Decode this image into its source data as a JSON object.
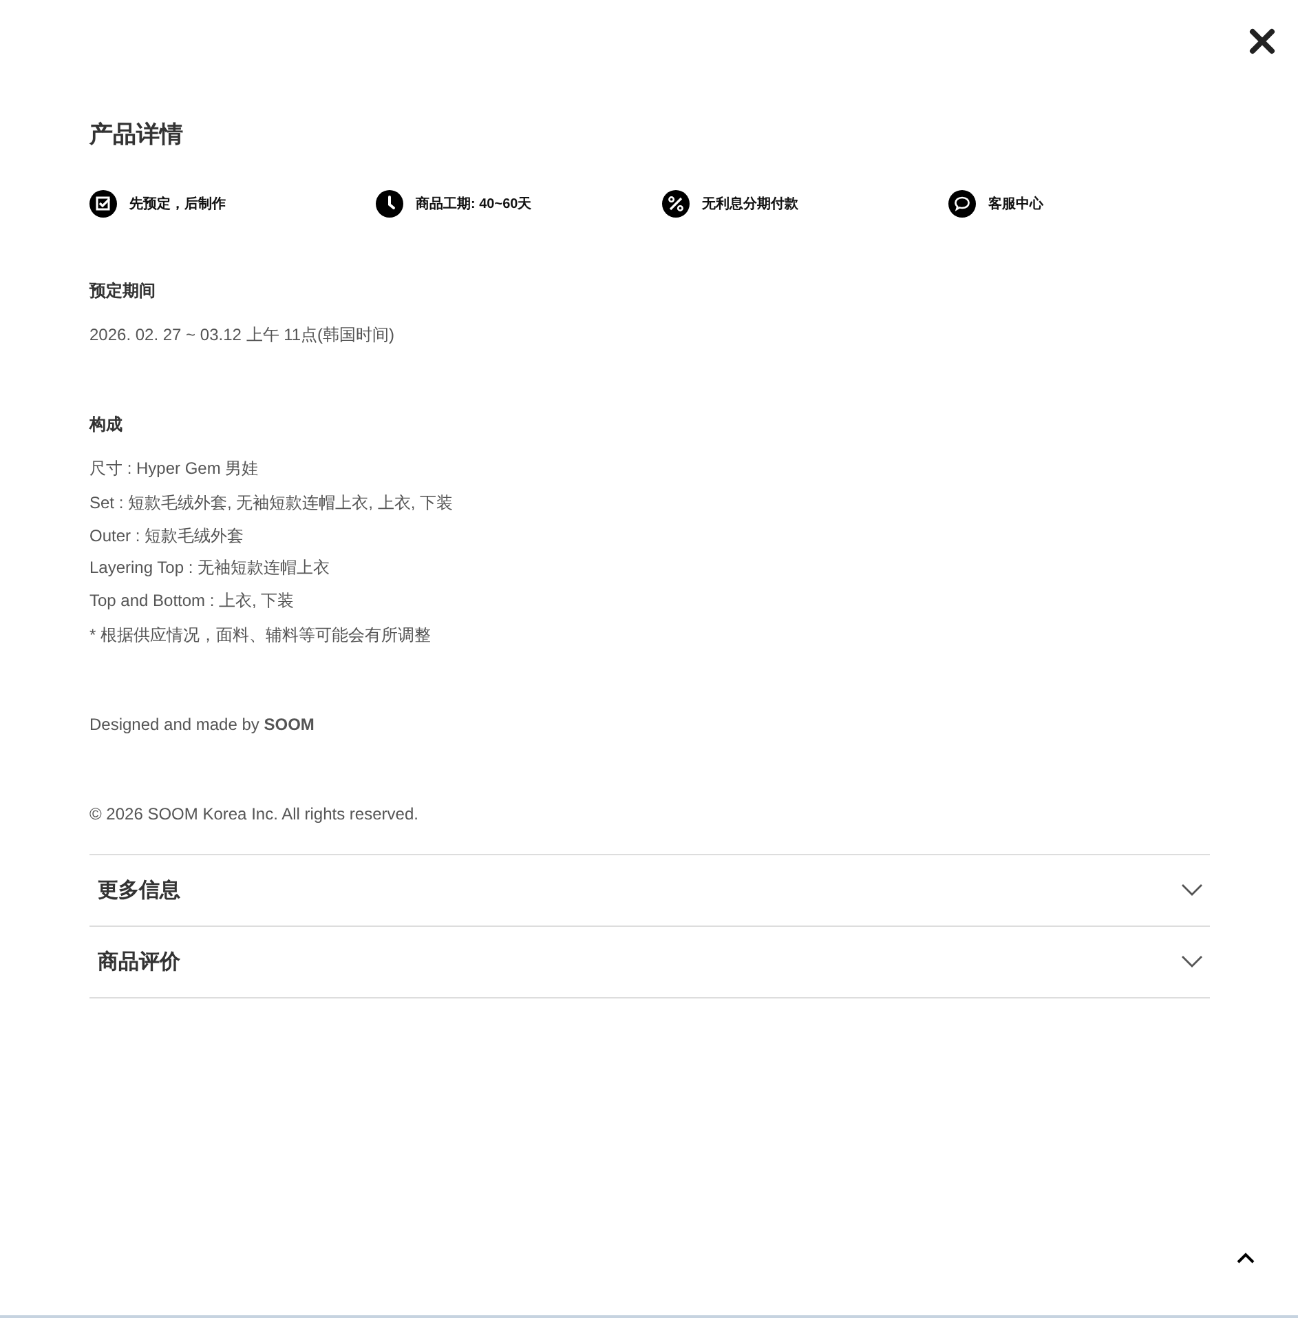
{
  "title": "产品详情",
  "features": [
    {
      "kind": "check",
      "label": "先预定，后制作"
    },
    {
      "kind": "clock",
      "label": "商品工期: 40~60天"
    },
    {
      "kind": "percent",
      "label": "无利息分期付款"
    },
    {
      "kind": "chat",
      "label": "客服中心"
    }
  ],
  "preorder": {
    "heading": "预定期间",
    "text": "2026. 02. 27 ~ 03.12 上午 11点(韩国时间)"
  },
  "composition": {
    "heading": "构成",
    "size": "尺寸 : Hyper Gem 男娃",
    "items": [
      "Set : 短款毛绒外套, 无袖短款连帽上衣, 上衣, 下装",
      "Outer : 短款毛绒外套",
      "Layering Top : 无袖短款连帽上衣",
      "Top and Bottom : 上衣, 下装"
    ],
    "note": "* 根据供应情况，面料、辅料等可能会有所调整"
  },
  "credit": "Designed and made by **SOOM**",
  "copyright": "© 2026 SOOM Korea Inc. All rights reserved.",
  "accordions": [
    {
      "label": "更多信息",
      "expanded": false
    },
    {
      "label": "商品评价",
      "expanded": false
    }
  ]
}
